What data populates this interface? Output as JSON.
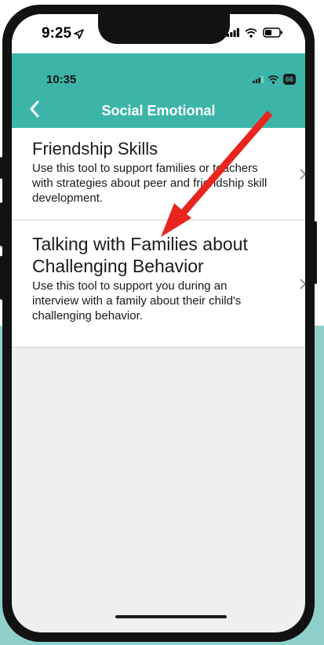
{
  "outer_status": {
    "time": "9:25"
  },
  "inner_status": {
    "time": "10:35",
    "battery": "66"
  },
  "header": {
    "title": "Social Emotional"
  },
  "items": [
    {
      "title": "Friendship Skills",
      "description": "Use this tool to support families or teachers with strategies about peer and friendship skill development."
    },
    {
      "title": "Talking with Families about Challenging Behavior",
      "description": "Use this tool to support you during an interview with a family about their child's challenging behavior."
    }
  ],
  "colors": {
    "header": "#3cb5a8",
    "annotation_arrow": "#e8261f",
    "page_background": "#8fd0cd"
  },
  "icons": [
    "location-arrow-icon",
    "signal-icon",
    "wifi-icon",
    "battery-icon",
    "back-chevron-icon",
    "chevron-right-icon",
    "annotation-arrow"
  ]
}
